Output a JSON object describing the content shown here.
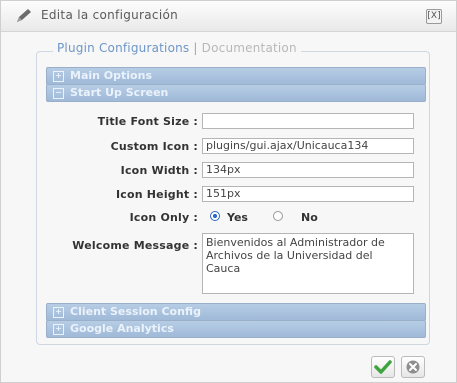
{
  "dialog": {
    "title": "Edita la configuración",
    "close_label": "[X]"
  },
  "tabs": {
    "active": "Plugin Configurations",
    "separator": "|",
    "inactive": "Documentation"
  },
  "sections": {
    "main_options": {
      "toggle": "+",
      "label": "Main Options"
    },
    "startup_screen": {
      "toggle": "−",
      "label": "Start Up Screen"
    },
    "client_session": {
      "toggle": "+",
      "label": "Client Session Config"
    },
    "google_analytics": {
      "toggle": "+",
      "label": "Google Analytics"
    }
  },
  "form": {
    "title_font_size": {
      "label": "Title Font Size :",
      "value": ""
    },
    "custom_icon": {
      "label": "Custom Icon :",
      "value": "plugins/gui.ajax/Unicauca134"
    },
    "icon_width": {
      "label": "Icon Width :",
      "value": "134px"
    },
    "icon_height": {
      "label": "Icon Height :",
      "value": "151px"
    },
    "icon_only": {
      "label": "Icon Only :",
      "yes": "Yes",
      "no": "No",
      "selected": "Yes"
    },
    "welcome_message": {
      "label": "Welcome Message :",
      "value": "Bienvenidos al Administrador de Archivos de la Universidad del Cauca"
    }
  },
  "colors": {
    "section_bar": "#a9c2df",
    "tab_active": "#6e96c6",
    "save_check": "#3fa43f"
  },
  "icons": {
    "title": "pencil-icon",
    "save": "check-icon",
    "cancel": "cancel-icon"
  }
}
